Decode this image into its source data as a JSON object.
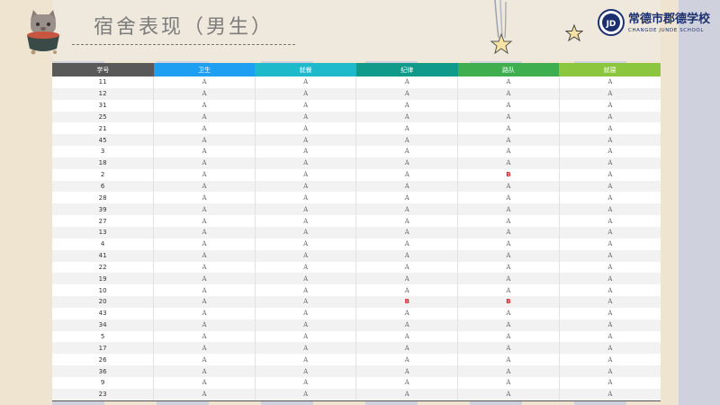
{
  "slide": {
    "title": "宿舍表现（男生）",
    "school_name_cn": "常德市郡德学校",
    "school_name_en": "CHANGDE JUNDE SCHOOL",
    "logo_glyph": "JD"
  },
  "table": {
    "columns": [
      {
        "label": "学号",
        "color": "#595959"
      },
      {
        "label": "卫生",
        "color": "#1e9ff2"
      },
      {
        "label": "就餐",
        "color": "#1fb9cc"
      },
      {
        "label": "纪律",
        "color": "#0f9a8a"
      },
      {
        "label": "路队",
        "color": "#3fae4f"
      },
      {
        "label": "就寝",
        "color": "#8cc63f"
      }
    ],
    "rows": [
      [
        "11",
        "A",
        "A",
        "A",
        "A",
        "A"
      ],
      [
        "12",
        "A",
        "A",
        "A",
        "A",
        "A"
      ],
      [
        "31",
        "A",
        "A",
        "A",
        "A",
        "A"
      ],
      [
        "25",
        "A",
        "A",
        "A",
        "A",
        "A"
      ],
      [
        "21",
        "A",
        "A",
        "A",
        "A",
        "A"
      ],
      [
        "45",
        "A",
        "A",
        "A",
        "A",
        "A"
      ],
      [
        "3",
        "A",
        "A",
        "A",
        "A",
        "A"
      ],
      [
        "18",
        "A",
        "A",
        "A",
        "A",
        "A"
      ],
      [
        "2",
        "A",
        "A",
        "A",
        "B",
        "A"
      ],
      [
        "6",
        "A",
        "A",
        "A",
        "A",
        "A"
      ],
      [
        "28",
        "A",
        "A",
        "A",
        "A",
        "A"
      ],
      [
        "39",
        "A",
        "A",
        "A",
        "A",
        "A"
      ],
      [
        "27",
        "A",
        "A",
        "A",
        "A",
        "A"
      ],
      [
        "13",
        "A",
        "A",
        "A",
        "A",
        "A"
      ],
      [
        "4",
        "A",
        "A",
        "A",
        "A",
        "A"
      ],
      [
        "41",
        "A",
        "A",
        "A",
        "A",
        "A"
      ],
      [
        "22",
        "A",
        "A",
        "A",
        "A",
        "A"
      ],
      [
        "19",
        "A",
        "A",
        "A",
        "A",
        "A"
      ],
      [
        "10",
        "A",
        "A",
        "A",
        "A",
        "A"
      ],
      [
        "20",
        "A",
        "A",
        "B",
        "B",
        "A"
      ],
      [
        "43",
        "A",
        "A",
        "A",
        "A",
        "A"
      ],
      [
        "34",
        "A",
        "A",
        "A",
        "A",
        "A"
      ],
      [
        "5",
        "A",
        "A",
        "A",
        "A",
        "A"
      ],
      [
        "17",
        "A",
        "A",
        "A",
        "A",
        "A"
      ],
      [
        "26",
        "A",
        "A",
        "A",
        "A",
        "A"
      ],
      [
        "36",
        "A",
        "A",
        "A",
        "A",
        "A"
      ],
      [
        "9",
        "A",
        "A",
        "A",
        "A",
        "A"
      ],
      [
        "23",
        "A",
        "A",
        "A",
        "A",
        "A"
      ]
    ]
  }
}
